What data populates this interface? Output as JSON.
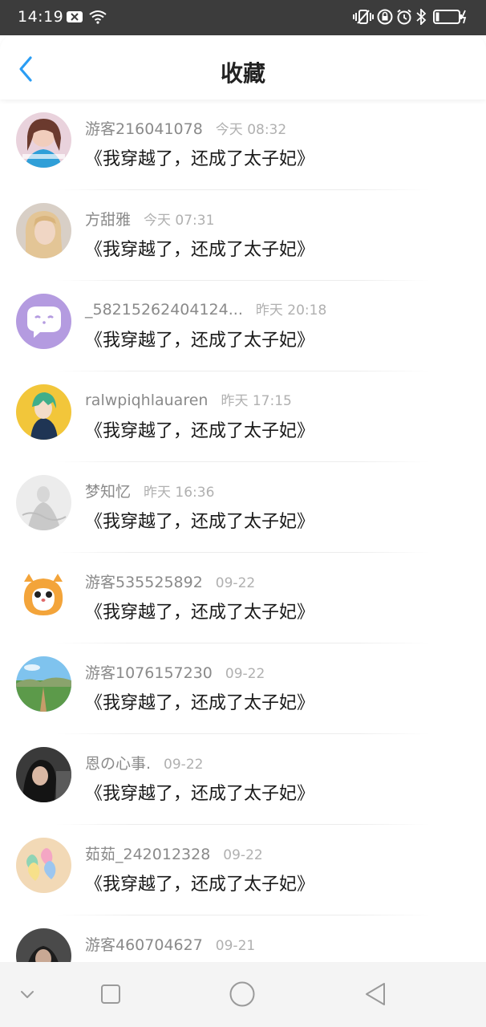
{
  "status_bar": {
    "time": "14:19"
  },
  "header": {
    "title": "收藏",
    "accent_color": "#2a9df4"
  },
  "favorites": [
    {
      "name": "游客216041078",
      "time": "今天 08:32",
      "content": "《我穿越了，还成了太子妃》",
      "avatar": "girl-photo"
    },
    {
      "name": "方甜雅",
      "time": "今天 07:31",
      "content": "《我穿越了，还成了太子妃》",
      "avatar": "blonde-photo"
    },
    {
      "name": "_58215262404124...",
      "time": "昨天 20:18",
      "content": "《我穿越了，还成了太子妃》",
      "avatar": "chat-bubble-default"
    },
    {
      "name": "ralwpiqhlauaren",
      "time": "昨天 17:15",
      "content": "《我穿越了，还成了太子妃》",
      "avatar": "anime-boy"
    },
    {
      "name": "梦知忆",
      "time": "昨天 16:36",
      "content": "《我穿越了，还成了太子妃》",
      "avatar": "sketch-girl"
    },
    {
      "name": "游客535525892",
      "time": "09-22",
      "content": "《我穿越了，还成了太子妃》",
      "avatar": "hamster"
    },
    {
      "name": "游客1076157230",
      "time": "09-22",
      "content": "《我穿越了，还成了太子妃》",
      "avatar": "landscape"
    },
    {
      "name": "恩の心事.",
      "time": "09-22",
      "content": "《我穿越了，还成了太子妃》",
      "avatar": "dark-photo"
    },
    {
      "name": "茹茹_242012328",
      "time": "09-22",
      "content": "《我穿越了，还成了太子妃》",
      "avatar": "hearts"
    },
    {
      "name": "游客460704627",
      "time": "09-21",
      "content": "",
      "avatar": "dark-photo-2"
    }
  ]
}
